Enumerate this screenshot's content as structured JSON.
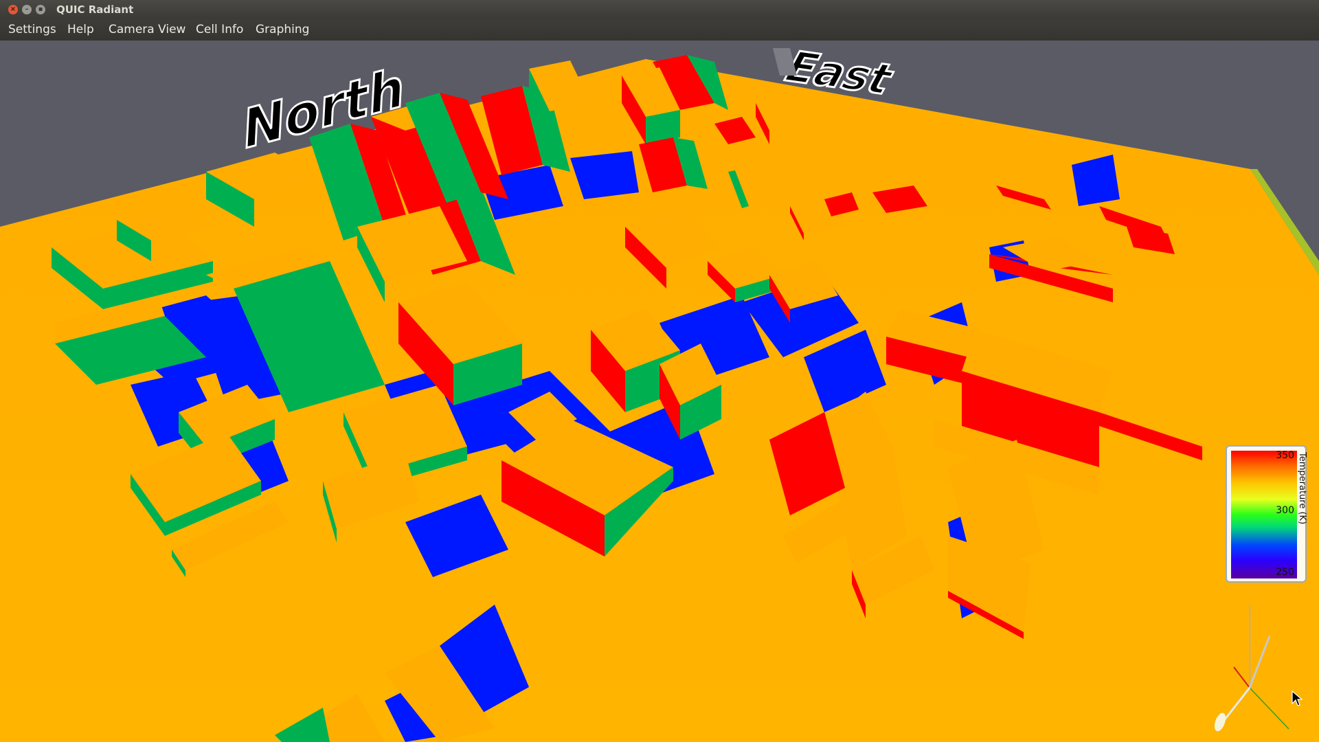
{
  "window": {
    "title": "QUIC Radiant"
  },
  "menu": {
    "items": [
      "Settings",
      "Help",
      "Camera View",
      "Cell Info",
      "Graphing"
    ]
  },
  "scene": {
    "compass_north": "North",
    "compass_east": "East",
    "colors": {
      "ground": "#ffb000",
      "hot": "#ff0000",
      "mid": "#00b050",
      "cold": "#0018ff",
      "background": "#5b5b66"
    }
  },
  "legend": {
    "title": "Temperature (K)",
    "ticks": [
      "350",
      "300",
      "250"
    ]
  },
  "icons": {
    "close": "close-icon",
    "minimize": "minimize-icon",
    "maximize": "maximize-icon",
    "axes": "axes-gizmo-icon",
    "cursor": "mouse-pointer-icon"
  }
}
